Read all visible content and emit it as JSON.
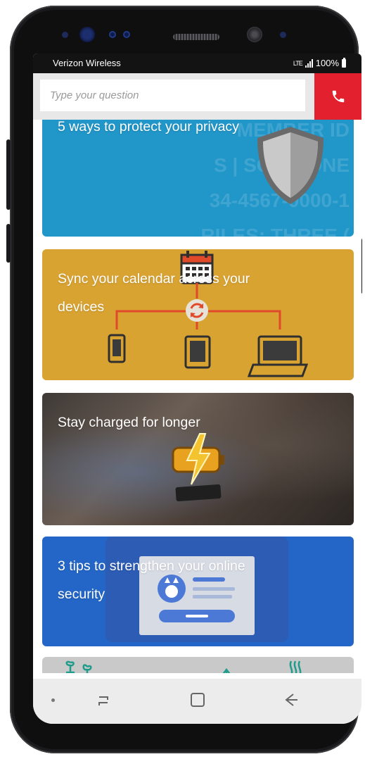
{
  "status_bar": {
    "carrier": "Verizon Wireless",
    "network": "LTE",
    "battery": "100%"
  },
  "search": {
    "placeholder": "Type your question"
  },
  "cards": [
    {
      "title": "5 ways to protect your privacy"
    },
    {
      "title": "Sync your calendar across your devices"
    },
    {
      "title": "Stay charged for longer"
    },
    {
      "title": "3 tips to strengthen your online security"
    }
  ],
  "privacy_background_text": [
    "MEMBER ID",
    "S | SOME ONE",
    "34-4567-0000-1",
    "RILES: THREE ("
  ],
  "icons": {
    "call": "phone-icon",
    "shield": "shield-icon",
    "calendar": "calendar-icon",
    "sync": "sync-icon",
    "phone_device": "smartphone-icon",
    "tablet_device": "tablet-icon",
    "laptop_device": "laptop-icon",
    "battery_bolt": "battery-bolt-icon",
    "profile_card": "profile-card-icon",
    "nav_recent": "recent-apps-icon",
    "nav_home": "home-icon",
    "nav_back": "back-icon"
  },
  "colors": {
    "accent_red": "#e3212e",
    "privacy_card": "#2196c9",
    "calendar_card": "#d9a332",
    "security_card": "#2466c7"
  }
}
